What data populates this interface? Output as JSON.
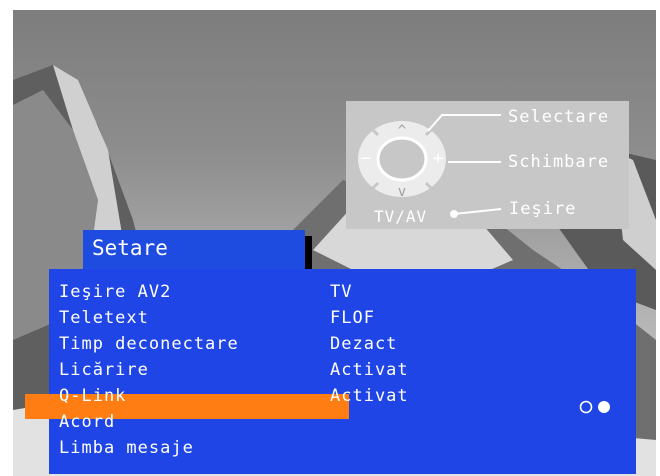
{
  "remote": {
    "select_label": "Selectare",
    "change_label": "Schimbare",
    "exit_label": "Ieşire",
    "tvav_label": "TV/AV",
    "up_symbol": "^",
    "down_symbol": "v",
    "plus_symbol": "+",
    "minus_symbol": "−"
  },
  "menu": {
    "title": "Setare",
    "items": [
      {
        "label": "Ieşire AV2",
        "value": "TV"
      },
      {
        "label": "Teletext",
        "value": "FLOF"
      },
      {
        "label": "Timp deconectare",
        "value": "Dezact"
      },
      {
        "label": "Licărire",
        "value": "Activat"
      },
      {
        "label": "Q-Link",
        "value": "Activat",
        "selected": true
      },
      {
        "label": "Acord",
        "value": ""
      },
      {
        "label": "Limba mesaje",
        "value": ""
      }
    ]
  },
  "colors": {
    "menu_blue": "#1f45e6",
    "highlight_orange": "#ff7d12",
    "remote_panel_gray": "#c7c7c7"
  },
  "icons": {
    "remote": "remote-dial-icon",
    "indicator": "toggle-dots-icon"
  }
}
